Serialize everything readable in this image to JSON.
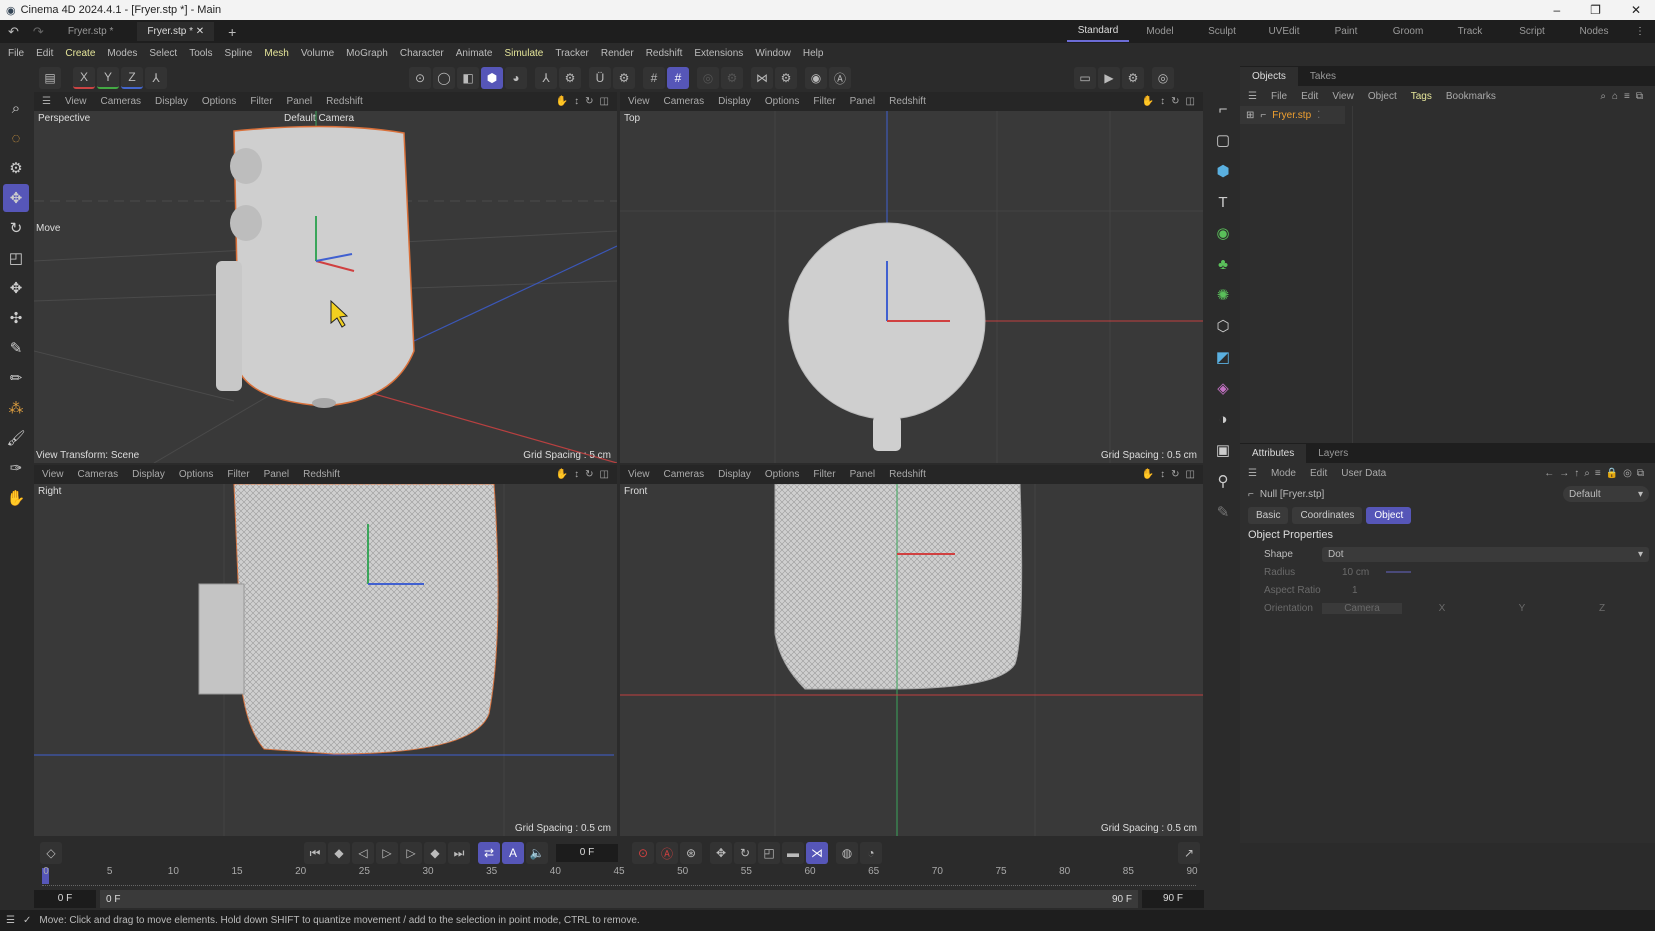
{
  "window": {
    "title": "Cinema 4D 2024.4.1 - [Fryer.stp *] - Main",
    "controls": [
      "–",
      "❐",
      "✕"
    ]
  },
  "doc_tabs": [
    {
      "label": "Fryer.stp *",
      "active": false
    },
    {
      "label": "Fryer.stp *",
      "active": true
    }
  ],
  "layouts": [
    {
      "label": "Standard",
      "active": true
    },
    {
      "label": "Model"
    },
    {
      "label": "Sculpt"
    },
    {
      "label": "UVEdit"
    },
    {
      "label": "Paint"
    },
    {
      "label": "Groom"
    },
    {
      "label": "Track"
    },
    {
      "label": "Script"
    },
    {
      "label": "Nodes"
    }
  ],
  "menu": [
    {
      "label": "File"
    },
    {
      "label": "Edit"
    },
    {
      "label": "Create",
      "hl": true
    },
    {
      "label": "Modes"
    },
    {
      "label": "Select"
    },
    {
      "label": "Tools"
    },
    {
      "label": "Spline"
    },
    {
      "label": "Mesh",
      "hl": true
    },
    {
      "label": "Volume"
    },
    {
      "label": "MoGraph"
    },
    {
      "label": "Character"
    },
    {
      "label": "Animate"
    },
    {
      "label": "Simulate",
      "hl": true
    },
    {
      "label": "Tracker"
    },
    {
      "label": "Render"
    },
    {
      "label": "Redshift"
    },
    {
      "label": "Extensions"
    },
    {
      "label": "Window"
    },
    {
      "label": "Help"
    }
  ],
  "axis_buttons": [
    "X",
    "Y",
    "Z"
  ],
  "viewport_menu": [
    "View",
    "Cameras",
    "Display",
    "Options",
    "Filter",
    "Panel",
    "Redshift"
  ],
  "viewports": [
    {
      "name": "Perspective",
      "camera": "Default Camera",
      "overlay": "Move",
      "transform": "View Transform: Scene",
      "grid": "Grid Spacing : 5 cm"
    },
    {
      "name": "Top",
      "grid": "Grid Spacing : 0.5 cm"
    },
    {
      "name": "Right",
      "grid": "Grid Spacing : 0.5 cm"
    },
    {
      "name": "Front",
      "grid": "Grid Spacing : 0.5 cm"
    }
  ],
  "objects": {
    "tabs": [
      "Objects",
      "Takes"
    ],
    "menu": [
      "File",
      "Edit",
      "View",
      "Object",
      "Tags",
      "Bookmarks"
    ],
    "items": [
      {
        "name": "Fryer.stp"
      }
    ]
  },
  "attributes": {
    "tabs": [
      "Attributes",
      "Layers"
    ],
    "menu": [
      "Mode",
      "Edit",
      "User Data"
    ],
    "object": "Null [Fryer.stp]",
    "preset": "Default",
    "subtabs": [
      "Basic",
      "Coordinates",
      "Object"
    ],
    "active_subtab": "Object",
    "section": "Object Properties",
    "props": [
      {
        "label": "Shape",
        "value": "Dot"
      },
      {
        "label": "Radius",
        "value": "10 cm"
      },
      {
        "label": "Aspect Ratio",
        "value": "1"
      },
      {
        "label": "Orientation",
        "value": "Camera",
        "options": [
          "X",
          "Y",
          "Z"
        ]
      }
    ]
  },
  "timeline": {
    "current": "0 F",
    "ticks": [
      "0",
      "5",
      "10",
      "15",
      "20",
      "25",
      "30",
      "35",
      "40",
      "45",
      "50",
      "55",
      "60",
      "65",
      "70",
      "75",
      "80",
      "85",
      "90"
    ],
    "start": "0 F",
    "range_start": "0 F",
    "range_end": "90 F",
    "end": "90 F"
  },
  "status": "Move: Click and drag to move elements. Hold down SHIFT to quantize movement / add to the selection in point mode, CTRL to remove.",
  "colors": {
    "accent": "#5656b8",
    "selection": "#e07a3a",
    "x_axis": "#d04040",
    "y_axis": "#40c060",
    "z_axis": "#4060d0"
  }
}
